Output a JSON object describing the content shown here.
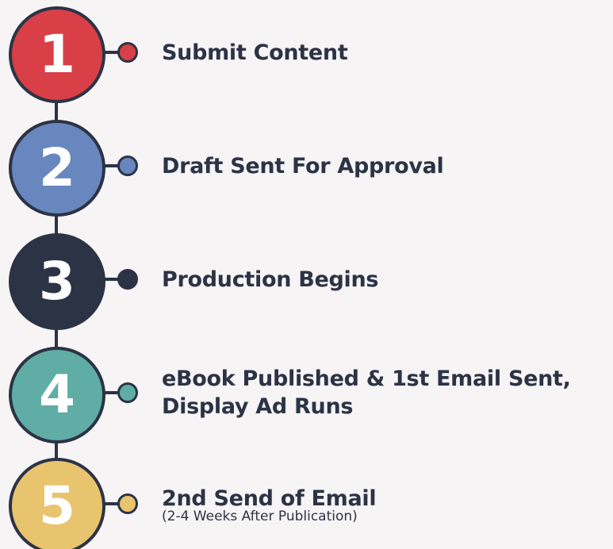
{
  "steps": [
    {
      "number": "1",
      "title_lines": [
        "Submit Content"
      ],
      "subtitle": "",
      "color": "#d93f46"
    },
    {
      "number": "2",
      "title_lines": [
        "Draft Sent For Approval"
      ],
      "subtitle": "",
      "color": "#6787be"
    },
    {
      "number": "3",
      "title_lines": [
        "Production Begins"
      ],
      "subtitle": "",
      "color": "#2c3345"
    },
    {
      "number": "4",
      "title_lines": [
        "eBook Published & 1st Email Sent,",
        "Display Ad Runs"
      ],
      "subtitle": "",
      "color": "#5fada5"
    },
    {
      "number": "5",
      "title_lines": [
        "2nd Send of Email"
      ],
      "subtitle": "(2-4 Weeks After Publication)",
      "color": "#e8c46e"
    }
  ],
  "colors": {
    "outline": "#2c3345",
    "background": "#f6f4f5"
  }
}
